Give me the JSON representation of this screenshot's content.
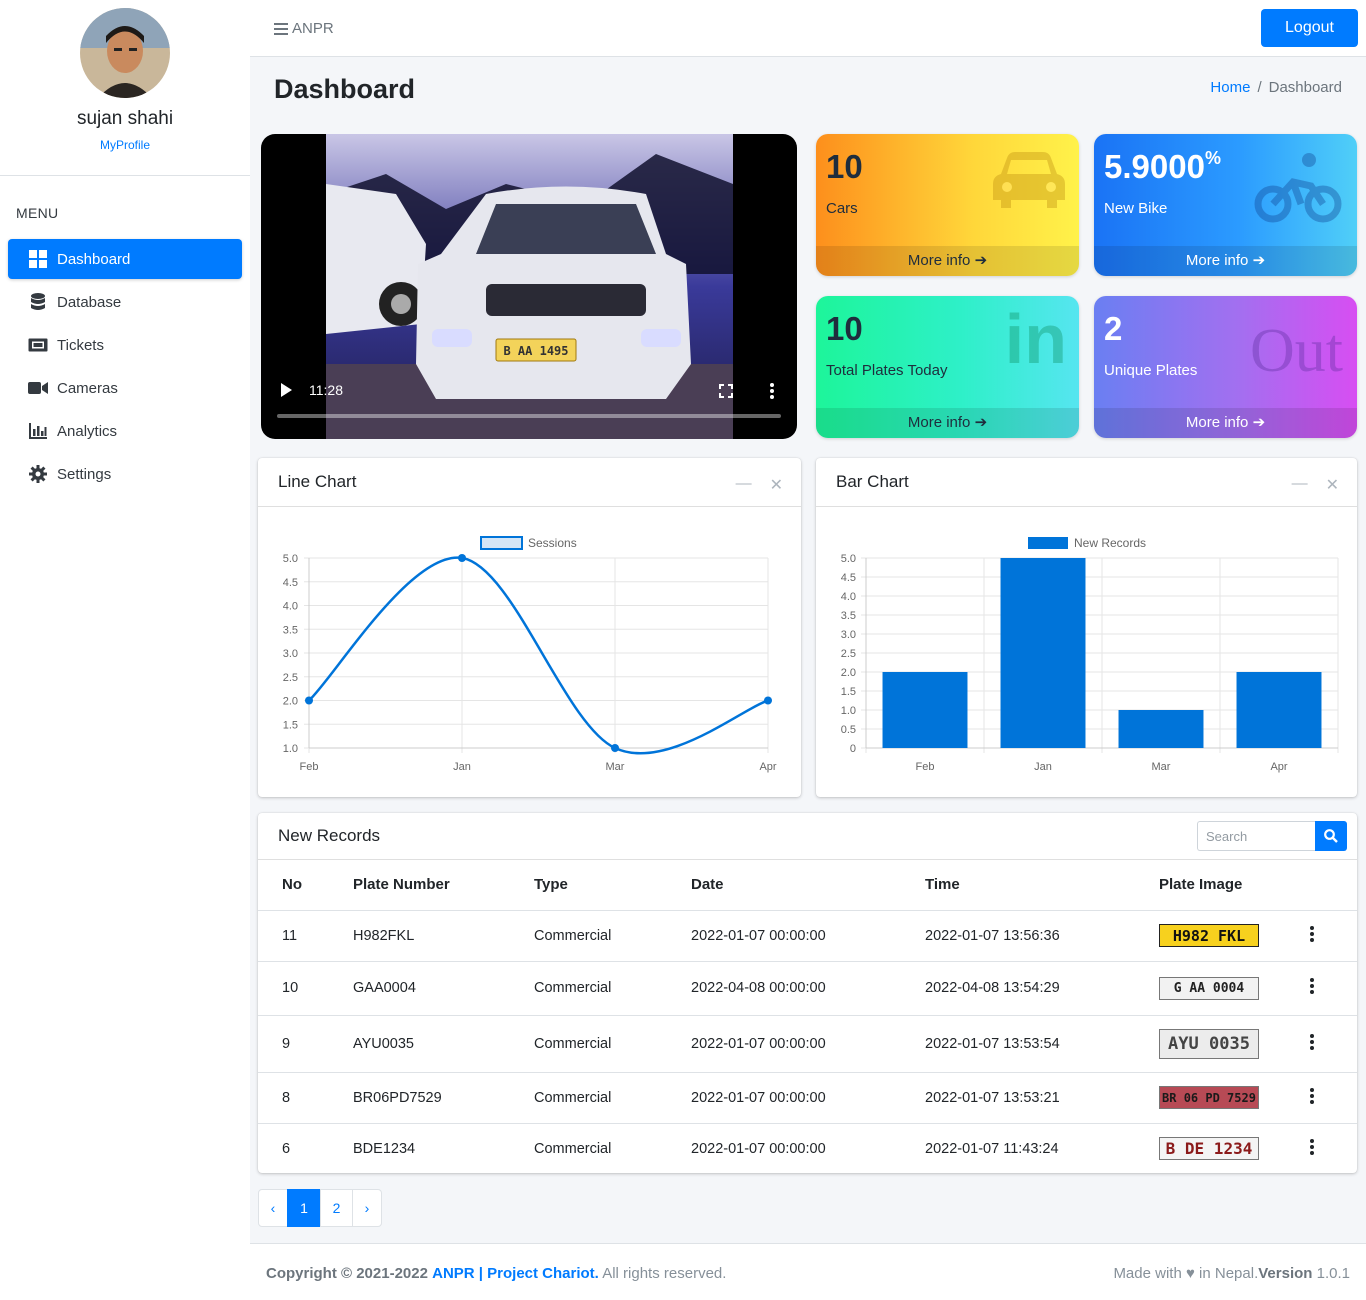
{
  "user": {
    "name": "sujan shahi",
    "profile_link": "MyProfile"
  },
  "menu": {
    "title": "MENU",
    "items": [
      {
        "label": "Dashboard",
        "icon": "dashboard-icon",
        "active": true
      },
      {
        "label": "Database",
        "icon": "database-icon"
      },
      {
        "label": "Tickets",
        "icon": "ticket-icon"
      },
      {
        "label": "Cameras",
        "icon": "camera-icon"
      },
      {
        "label": "Analytics",
        "icon": "analytics-icon"
      },
      {
        "label": "Settings",
        "icon": "gear-icon"
      }
    ]
  },
  "header": {
    "brand": "ANPR",
    "logout_label": "Logout"
  },
  "page": {
    "title": "Dashboard",
    "breadcrumb": {
      "home": "Home",
      "sep": "/",
      "current": "Dashboard"
    }
  },
  "video": {
    "time": "11:28",
    "plate_text": "B AA 1495"
  },
  "info_boxes": {
    "cars": {
      "value": "10",
      "label": "Cars",
      "more": "More info"
    },
    "bike": {
      "value": "5.9000",
      "unit": "%",
      "label": "New Bike",
      "more": "More info"
    },
    "plates": {
      "value": "10",
      "label": "Total Plates Today",
      "more": "More info",
      "icon_text": "in"
    },
    "unique": {
      "value": "2",
      "label": "Unique Plates",
      "more": "More info",
      "icon_text": "Out"
    }
  },
  "line_card": {
    "title": "Line Chart"
  },
  "bar_card": {
    "title": "Bar Chart"
  },
  "chart_data": [
    {
      "type": "line",
      "categories": [
        "Feb",
        "Jan",
        "Mar",
        "Apr"
      ],
      "series": [
        {
          "name": "Sessions",
          "values": [
            2,
            5,
            1,
            2
          ]
        }
      ],
      "ylim": [
        1,
        5
      ],
      "yticks": [
        "5.0",
        "4.5",
        "4.0",
        "3.5",
        "3.0",
        "2.5",
        "2.0",
        "1.5",
        "1.0"
      ],
      "grid": true,
      "legend": "top"
    },
    {
      "type": "bar",
      "categories": [
        "Feb",
        "Jan",
        "Mar",
        "Apr"
      ],
      "series": [
        {
          "name": "New Records",
          "values": [
            2,
            5,
            1,
            2
          ]
        }
      ],
      "ylim": [
        0,
        5
      ],
      "yticks": [
        "5.0",
        "4.5",
        "4.0",
        "3.5",
        "3.0",
        "2.5",
        "2.0",
        "1.5",
        "1.0",
        "0.5",
        "0"
      ],
      "grid": true,
      "legend": "top"
    }
  ],
  "records": {
    "title": "New Records",
    "search_placeholder": "Search",
    "columns": [
      "No",
      "Plate Number",
      "Type",
      "Date",
      "Time",
      "Plate Image"
    ],
    "rows": [
      {
        "no": "11",
        "plate": "H982FKL",
        "type": "Commercial",
        "date": "2022-01-07 00:00:00",
        "time": "2022-01-07 13:56:36",
        "img": "H982 FKL"
      },
      {
        "no": "10",
        "plate": "GAA0004",
        "type": "Commercial",
        "date": "2022-04-08 00:00:00",
        "time": "2022-04-08 13:54:29",
        "img": "G AA 0004"
      },
      {
        "no": "9",
        "plate": "AYU0035",
        "type": "Commercial",
        "date": "2022-01-07 00:00:00",
        "time": "2022-01-07 13:53:54",
        "img": "AYU 0035"
      },
      {
        "no": "8",
        "plate": "BR06PD7529",
        "type": "Commercial",
        "date": "2022-01-07 00:00:00",
        "time": "2022-01-07 13:53:21",
        "img": "BR 06 PD 7529"
      },
      {
        "no": "6",
        "plate": "BDE1234",
        "type": "Commercial",
        "date": "2022-01-07 00:00:00",
        "time": "2022-01-07 11:43:24",
        "img": "B DE 1234"
      }
    ]
  },
  "pagination": {
    "prev": "‹",
    "pages": [
      "1",
      "2"
    ],
    "next": "›",
    "active": "1"
  },
  "footer": {
    "copyright": "Copyright © 2021-2022",
    "brand": "ANPR | Project Chariot.",
    "rights": "All rights reserved.",
    "made": "Made with ♥ in Nepal.",
    "version_label": "Version",
    "version": "1.0.1"
  },
  "colors": {
    "primary": "#007bff",
    "chart": "#0074d9"
  }
}
